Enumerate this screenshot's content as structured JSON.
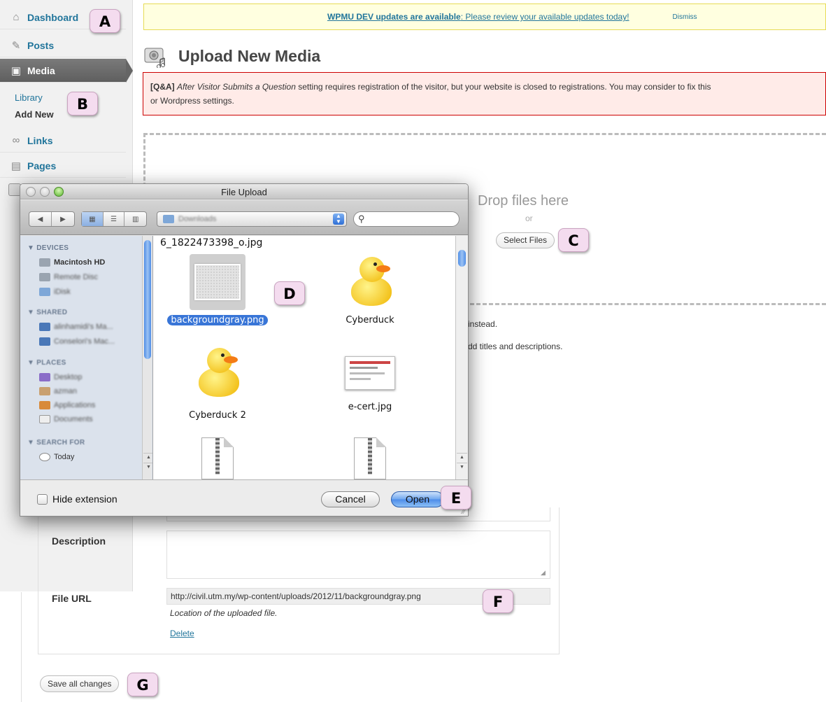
{
  "sidebar": {
    "items": [
      {
        "label": "Dashboard",
        "icon": "home-icon"
      },
      {
        "label": "Posts",
        "icon": "pin-icon"
      },
      {
        "label": "Media",
        "icon": "media-icon"
      },
      {
        "label": "Links",
        "icon": "link-icon"
      },
      {
        "label": "Pages",
        "icon": "page-icon"
      }
    ],
    "submenu": {
      "library": "Library",
      "add_new": "Add New"
    }
  },
  "notice": {
    "strong": "WPMU DEV updates are available",
    "rest": ": Please review your available updates today!",
    "dismiss": "Dismiss"
  },
  "page": {
    "title": "Upload New Media"
  },
  "error": {
    "tag": "[Q&A]",
    "setting": "After Visitor Submits a Question",
    "message": " setting requires registration of the visitor, but your website is closed to registrations. You may consider to fix this",
    "message2": "or Wordpress settings."
  },
  "uploader": {
    "drop_text": "Drop files here",
    "or_text": "or",
    "select_files": "Select Files",
    "browser_text": "instead.",
    "after_text": "dd titles and descriptions."
  },
  "media_item": {
    "description_label": "Description",
    "file_url_label": "File URL",
    "file_url_value": "http://civil.utm.my/wp-content/uploads/2012/11/backgroundgray.png",
    "file_url_help": "Location of the uploaded file.",
    "delete_link": "Delete"
  },
  "save_all_label": "Save all changes",
  "dialog": {
    "title": "File Upload",
    "location": "Downloads",
    "sidebar": {
      "devices_header": "▼ DEVICES",
      "devices": [
        "Macintosh HD",
        "Remote Disc",
        "iDisk"
      ],
      "shared_header": "▼ SHARED",
      "shared": [
        "alinhamidi's Ma...",
        "Conselori's Mac..."
      ],
      "places_header": "▼ PLACES",
      "places": [
        "Desktop",
        "azman",
        "Applications",
        "Documents"
      ],
      "search_header": "▼ SEARCH FOR",
      "search": [
        "Today"
      ]
    },
    "top_file": "6_1822473398_o.jpg",
    "files": [
      {
        "name": "backgroundgray.png",
        "kind": "image",
        "selected": true
      },
      {
        "name": "Cyberduck",
        "kind": "app",
        "selected": false
      },
      {
        "name": "Cyberduck 2",
        "kind": "app",
        "selected": false
      },
      {
        "name": "e-cert.jpg",
        "kind": "image",
        "selected": false
      }
    ],
    "hide_extension": "Hide extension",
    "cancel": "Cancel",
    "open": "Open"
  },
  "badges": [
    "A",
    "B",
    "C",
    "D",
    "E",
    "F",
    "G"
  ],
  "colors": {
    "wp_link": "#21759b",
    "selection": "#3875d7",
    "badge": "#f4dcef",
    "error_bg": "#ffebe8",
    "notice_bg": "#ffffe0"
  }
}
